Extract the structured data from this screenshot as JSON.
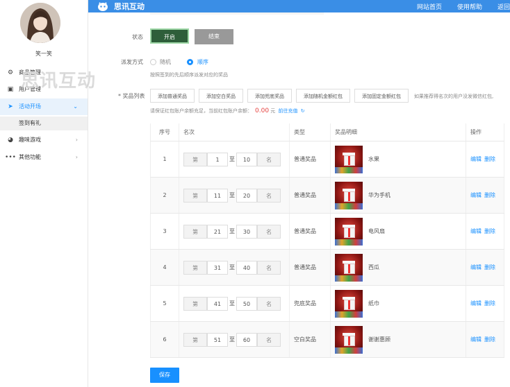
{
  "header": {
    "app_title": "思讯互动",
    "nav": [
      "网站首页",
      "使用帮助",
      "返回"
    ]
  },
  "sidebar": {
    "username": "笑一笑",
    "watermark": "思讯互动",
    "items": [
      {
        "label": "商品管理",
        "icon": "gear-icon"
      },
      {
        "label": "用户管理",
        "icon": "briefcase-icon"
      },
      {
        "label": "活动开场",
        "icon": "paper-plane-icon",
        "active": true
      },
      {
        "label": "趣味游戏",
        "icon": "gamepad-icon"
      },
      {
        "label": "其他功能",
        "icon": "ellipsis-icon"
      }
    ],
    "sub_item": "签到有礼"
  },
  "form": {
    "status_label": "状态",
    "status_on": "开启",
    "status_off": "结束",
    "dispatch_label": "派发方式",
    "radio_random": "随机",
    "radio_sequence": "顺序",
    "dispatch_hint": "按照签到的先后顺序派发对应的奖品",
    "prize_list_label": "* 奖品列表",
    "buttons": [
      "添加普通奖品",
      "添加空白奖品",
      "添加兜底奖品",
      "添加随机金额红包",
      "添加固定金额红包"
    ],
    "tip": "如果推荐得名次的用户没发微信红包,",
    "balance_text": "请保证红包账户余额充足，当前红包账户余额：",
    "balance_amount": "0.00",
    "balance_unit": "元",
    "recharge_link": "前往充值",
    "refresh_icon": "refresh-icon",
    "save": "保存"
  },
  "table": {
    "headers": [
      "序号",
      "名次",
      "类型",
      "奖品明细",
      "操作"
    ],
    "prefix": "第",
    "to": "至",
    "suffix": "名",
    "edit": "编辑",
    "delete": "删除",
    "rows": [
      {
        "idx": "1",
        "from": "1",
        "to": "10",
        "type": "普通奖品",
        "prize": "水果"
      },
      {
        "idx": "2",
        "from": "11",
        "to": "20",
        "type": "普通奖品",
        "prize": "华为手机"
      },
      {
        "idx": "3",
        "from": "21",
        "to": "30",
        "type": "普通奖品",
        "prize": "电风扇"
      },
      {
        "idx": "4",
        "from": "31",
        "to": "40",
        "type": "普通奖品",
        "prize": "西瓜"
      },
      {
        "idx": "5",
        "from": "41",
        "to": "50",
        "type": "兜底奖品",
        "prize": "纸巾"
      },
      {
        "idx": "6",
        "from": "51",
        "to": "60",
        "type": "空白奖品",
        "prize": "谢谢惠顾"
      }
    ]
  },
  "colors": {
    "header_blue": "#3a8ee6",
    "accent": "#1890ff",
    "status_on_bg": "#2e5e3a",
    "amount_red": "#e64340"
  }
}
